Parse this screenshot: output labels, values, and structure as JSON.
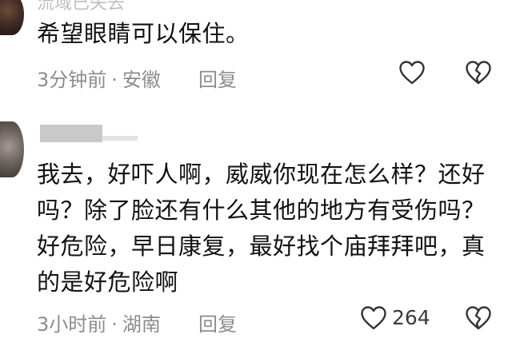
{
  "comments": [
    {
      "username": "流域已失去",
      "text": "希望眼睛可以保住。",
      "time": "3分钟前",
      "separator": "·",
      "location": "安徽",
      "reply_label": "回复",
      "like_icon": "heart-outline-icon",
      "dislike_icon": "broken-heart-icon"
    },
    {
      "text": "我去，好吓人啊，威威你现在怎么样？还好吗？除了脸还有什么其他的地方有受伤吗？好危险，早日康复，最好找个庙拜拜吧，真的是好危险啊",
      "time": "3小时前",
      "separator": "·",
      "location": "湖南",
      "reply_label": "回复",
      "like_count": "264",
      "like_icon": "heart-outline-icon",
      "dislike_icon": "broken-heart-icon"
    }
  ],
  "colors": {
    "text": "#111111",
    "meta": "#8c8c8c",
    "icon_stroke": "#333333"
  }
}
